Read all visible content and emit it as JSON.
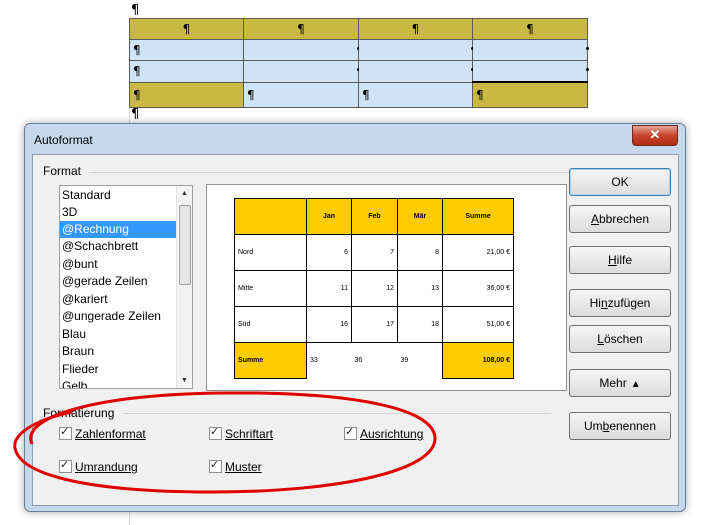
{
  "document": {
    "pilcrow": "¶",
    "table": {
      "header_row": [
        "¶",
        "¶",
        "¶",
        "¶"
      ],
      "body_rows": [
        [
          "¶",
          "",
          "",
          ""
        ],
        [
          "¶",
          "",
          "",
          ""
        ]
      ],
      "sum_row": [
        "¶",
        "¶",
        "¶",
        "¶"
      ]
    }
  },
  "dialog": {
    "title": "Autoformat",
    "close_glyph": "✕",
    "format_group": "Format",
    "format_list": [
      "Standard",
      "3D",
      "@Rechnung",
      "@Schachbrett",
      "@bunt",
      "@gerade Zeilen",
      "@kariert",
      "@ungerade Zeilen",
      "Blau",
      "Braun",
      "Flieder",
      "Gelb"
    ],
    "selected_format": "@Rechnung",
    "scroll_up": "▲",
    "scroll_down": "▼",
    "preview": {
      "header": [
        "",
        "Jan",
        "Feb",
        "Mär",
        "Summe"
      ],
      "rows": [
        [
          "Nord",
          "6",
          "7",
          "8",
          "21,00 €"
        ],
        [
          "Mitte",
          "11",
          "12",
          "13",
          "36,00 €"
        ],
        [
          "Süd",
          "16",
          "17",
          "18",
          "51,00 €"
        ]
      ],
      "sum_row": [
        "Summe",
        "33",
        "36",
        "39",
        "108,00 €"
      ]
    },
    "buttons": {
      "ok": "OK",
      "cancel_pre": "",
      "cancel_u": "A",
      "cancel_post": "bbrechen",
      "help_pre": "",
      "help_u": "H",
      "help_post": "ilfe",
      "add_pre": "Hi",
      "add_u": "n",
      "add_post": "zufügen",
      "delete_pre": "",
      "delete_u": "L",
      "delete_post": "öschen",
      "more": "Mehr",
      "more_arrow": "▲",
      "rename_pre": "Um",
      "rename_u": "b",
      "rename_post": "enennen"
    },
    "formatting_group": "Formatierung",
    "checkboxes": {
      "number_format": "Zahlenformat",
      "font": "Schriftart",
      "alignment": "Ausrichtung",
      "border": "Umrandung",
      "pattern": "Muster"
    },
    "colors": {
      "preview_highlight": "#ffcc00",
      "selection": "#3399ff",
      "annotation": "#e00000",
      "doc_header": "#c9b843",
      "doc_body": "#cfe3f6"
    }
  }
}
